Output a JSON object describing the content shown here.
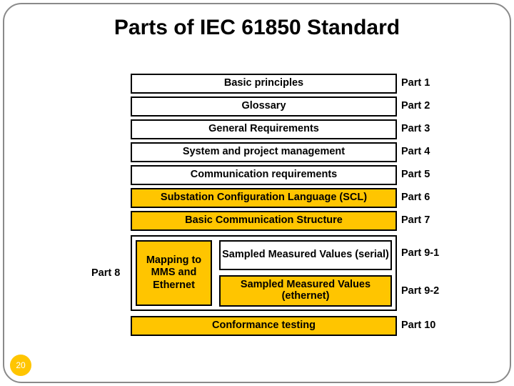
{
  "slide": {
    "title": "Parts of IEC 61850 Standard",
    "page_number": "20",
    "accent_color": "#ffc500",
    "border_color": "#000000"
  },
  "diagram": {
    "rows": [
      {
        "label": "Basic principles",
        "part": "Part 1",
        "fill": "white"
      },
      {
        "label": "Glossary",
        "part": "Part 2",
        "fill": "white"
      },
      {
        "label": "General Requirements",
        "part": "Part 3",
        "fill": "white"
      },
      {
        "label": "System and project management",
        "part": "Part 4",
        "fill": "white"
      },
      {
        "label": "Communication requirements",
        "part": "Part 5",
        "fill": "white"
      },
      {
        "label": "Substation Configuration Language (SCL)",
        "part": "Part 6",
        "fill": "yellow"
      },
      {
        "label": "Basic Communication Structure",
        "part": "Part 7",
        "fill": "yellow"
      }
    ],
    "group": {
      "part_label": "Part 8",
      "mapping_label": "Mapping to MMS and Ethernet",
      "inner_rows": [
        {
          "label": "Sampled Measured Values (serial)",
          "part": "Part 9-1",
          "fill": "white"
        },
        {
          "label": "Sampled Measured Values (ethernet)",
          "part": "Part 9-2",
          "fill": "yellow"
        }
      ]
    },
    "footer_row": {
      "label": "Conformance testing",
      "part": "Part 10",
      "fill": "yellow"
    }
  }
}
